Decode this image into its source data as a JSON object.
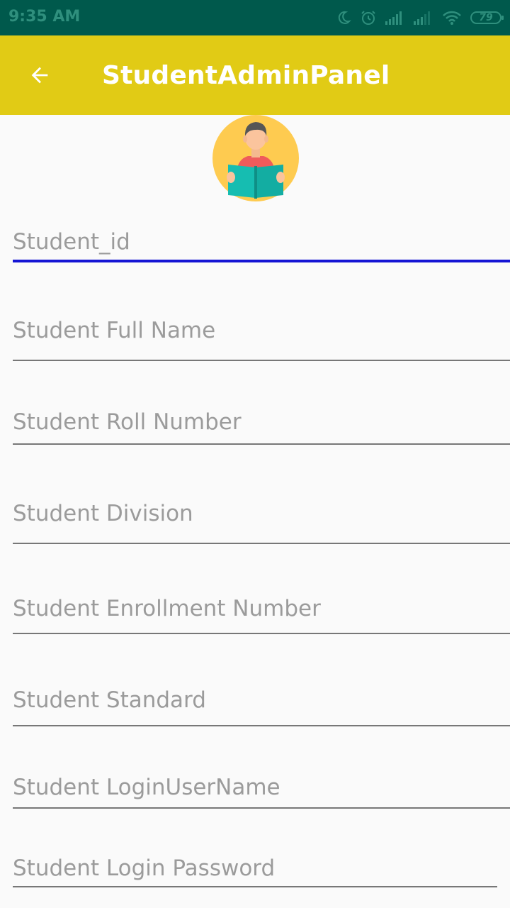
{
  "status_bar": {
    "time": "9:35 AM",
    "battery": "79",
    "icons": [
      "moon-icon",
      "alarm-icon",
      "signal-icon",
      "signal-icon-2",
      "wifi-icon",
      "battery-icon"
    ]
  },
  "app_bar": {
    "title": "StudentAdminPanel",
    "back_icon": "arrow-left-icon",
    "background": "#e1cb15"
  },
  "form": {
    "student_id": {
      "placeholder": "Student_id",
      "value": ""
    },
    "full_name": {
      "placeholder": "Student Full Name",
      "value": ""
    },
    "roll_number": {
      "placeholder": "Student Roll Number",
      "value": ""
    },
    "division": {
      "placeholder": "Student Division",
      "value": ""
    },
    "enrollment_number": {
      "placeholder": "Student Enrollment Number",
      "value": ""
    },
    "standard": {
      "placeholder": "Student Standard",
      "value": ""
    },
    "login_username": {
      "placeholder": "Student LoginUserName",
      "value": ""
    },
    "login_password": {
      "placeholder": "Student Login Password",
      "value": ""
    }
  },
  "colors": {
    "status_bar": "#00594c",
    "focus_underline": "#1515d4",
    "underline": "#777777",
    "placeholder": "#9b9b9b"
  }
}
